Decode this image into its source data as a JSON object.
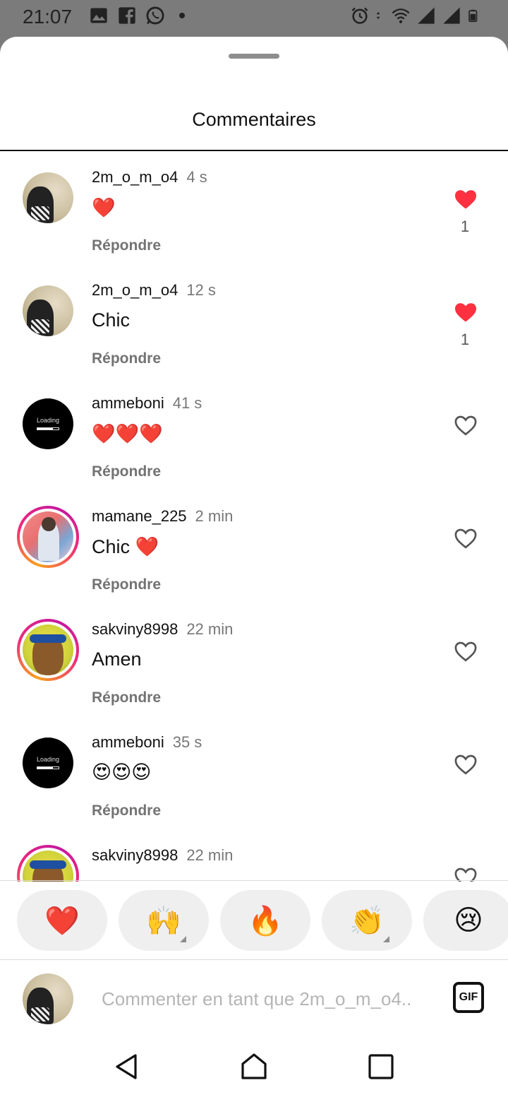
{
  "status_bar": {
    "time": "21:07",
    "left_icons": [
      "image-icon",
      "facebook-icon",
      "whatsapp-icon",
      "dot-icon"
    ],
    "right_icons": [
      "alarm-icon",
      "data-arrows-icon",
      "wifi-icon",
      "signal-icon",
      "signal-icon",
      "battery-icon"
    ]
  },
  "sheet": {
    "title": "Commentaires"
  },
  "comments": [
    {
      "username": "2m_o_m_o4",
      "time": "4 s",
      "text": "❤️",
      "reply": "Répondre",
      "liked": true,
      "likes": "1",
      "avatar": "photo"
    },
    {
      "username": "2m_o_m_o4",
      "time": "12 s",
      "text": "Chic",
      "reply": "Répondre",
      "liked": true,
      "likes": "1",
      "avatar": "photo"
    },
    {
      "username": "ammeboni",
      "time": "41 s",
      "text": "❤️❤️❤️",
      "reply": "Répondre",
      "liked": false,
      "likes": "",
      "avatar": "loading"
    },
    {
      "username": "mamane_225",
      "time": "2 min",
      "text": "Chic ❤️",
      "reply": "Répondre",
      "liked": false,
      "likes": "",
      "avatar": "graffiti",
      "story_ring": true
    },
    {
      "username": "sakviny8998",
      "time": "22 min",
      "text": "Amen",
      "reply": "Répondre",
      "liked": false,
      "likes": "",
      "avatar": "cartoon",
      "story_ring": true
    },
    {
      "username": "ammeboni",
      "time": "35 s",
      "text": "😍😍😍",
      "reply": "Répondre",
      "liked": false,
      "likes": "",
      "avatar": "loading"
    },
    {
      "username": "sakviny8998",
      "time": "22 min",
      "text": "",
      "reply": "",
      "liked": false,
      "likes": "",
      "avatar": "cartoon",
      "story_ring": true
    }
  ],
  "loading_avatar_text": "Loading",
  "reactions": [
    {
      "emoji": "❤️",
      "name": "heart",
      "has_variants": false
    },
    {
      "emoji": "🙌",
      "name": "raising-hands",
      "has_variants": true
    },
    {
      "emoji": "🔥",
      "name": "fire",
      "has_variants": false
    },
    {
      "emoji": "👏",
      "name": "clapping-hands",
      "has_variants": true
    },
    {
      "emoji": "😢",
      "name": "crying-face",
      "has_variants": false
    }
  ],
  "composer": {
    "placeholder": "Commenter en tant que 2m_o_m_o4..",
    "gif_label": "GIF"
  },
  "colors": {
    "like_red": "#ff3040",
    "status_bar_bg": "#7b7b7b",
    "reply_gray": "#737373"
  }
}
